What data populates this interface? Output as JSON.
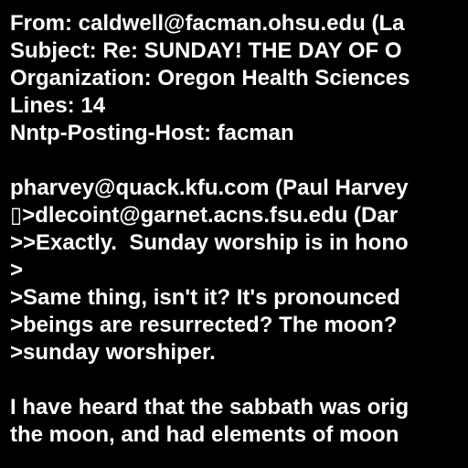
{
  "colors": {
    "background": "#000000",
    "text": "#ffffff"
  },
  "header": {
    "from": "From: caldwell@facman.ohsu.edu (La",
    "subject": "Subject: Re: SUNDAY! THE DAY OF O",
    "organization": "Organization: Oregon Health Sciences",
    "lines": "Lines: 14",
    "posting_host": "Nntp-Posting-Host: facman"
  },
  "body": {
    "attribution_1": "pharvey@quack.kfu.com (Paul Harvey",
    "attribution_2": "▯>dlecoint@garnet.acns.fsu.edu (Dar",
    "quote_1": ">>Exactly.  Sunday worship is in hono",
    "quote_2": ">",
    "quote_3": ">Same thing, isn't it? It's pronounced",
    "quote_4": ">beings are resurrected? The moon?",
    "quote_5": ">sunday worshiper.",
    "reply_1": "I have heard that the sabbath was orig",
    "reply_2": "the moon, and had elements of moon"
  }
}
